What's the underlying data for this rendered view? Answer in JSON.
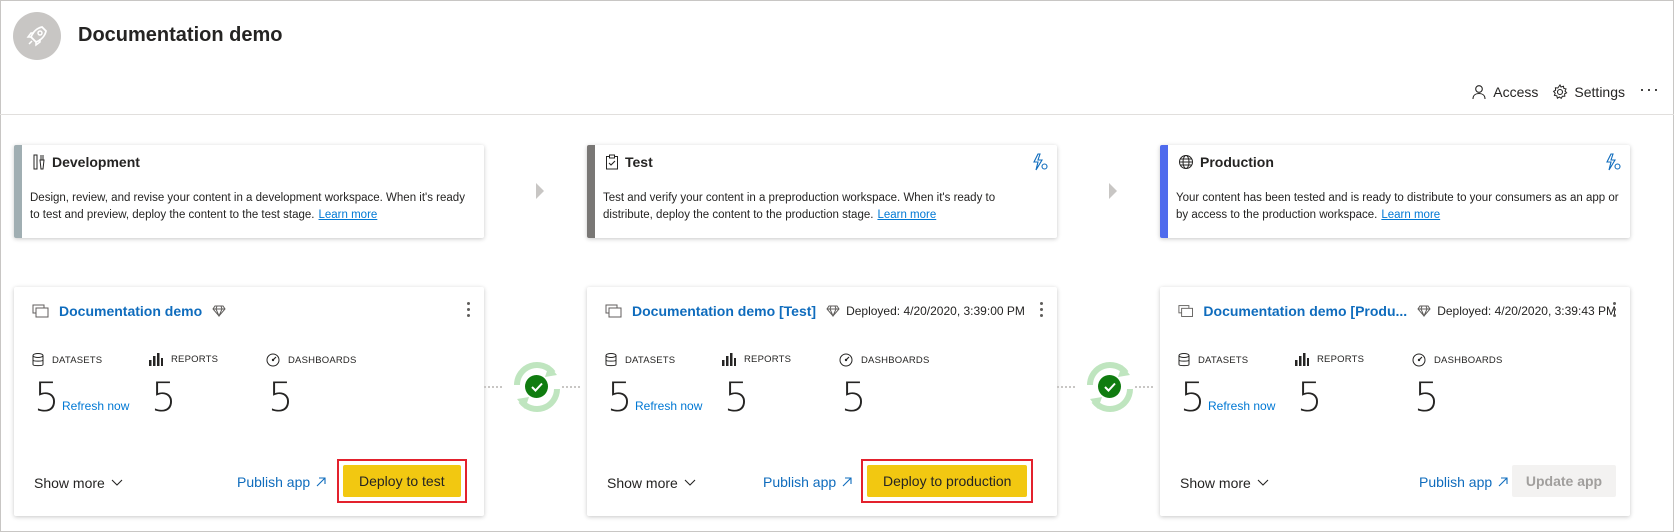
{
  "header": {
    "title": "Documentation demo",
    "access_label": "Access",
    "settings_label": "Settings",
    "more_label": "···"
  },
  "stages": [
    {
      "name": "Development",
      "color": "#a0aeb2",
      "description": "Design, review, and revise your content in a development workspace. When it's ready to test and preview, deploy the content to the test stage.",
      "learn_more": "Learn more",
      "icon": "tools-icon"
    },
    {
      "name": "Test",
      "color": "#797775",
      "description": "Test and verify your content in a preproduction workspace. When it's ready to distribute, deploy the content to the production stage.",
      "learn_more": "Learn more",
      "icon": "clipboard-check-icon"
    },
    {
      "name": "Production",
      "color": "#4f6bed",
      "description": "Your content has been tested and is ready to distribute to your consumers as an app or by access to the production workspace.",
      "learn_more": "Learn more",
      "icon": "globe-icon"
    }
  ],
  "workspaces": [
    {
      "name": "Documentation demo",
      "deployed": "",
      "datasets_label": "DATASETS",
      "datasets_count": "5",
      "refresh_label": "Refresh now",
      "reports_label": "REPORTS",
      "reports_count": "5",
      "dashboards_label": "DASHBOARDS",
      "dashboards_count": "5",
      "show_more": "Show more",
      "publish_app": "Publish app",
      "action_label": "Deploy to test"
    },
    {
      "name": "Documentation demo [Test]",
      "deployed": "Deployed: 4/20/2020, 3:39:00 PM",
      "datasets_label": "DATASETS",
      "datasets_count": "5",
      "refresh_label": "Refresh now",
      "reports_label": "REPORTS",
      "reports_count": "5",
      "dashboards_label": "DASHBOARDS",
      "dashboards_count": "5",
      "show_more": "Show more",
      "publish_app": "Publish app",
      "action_label": "Deploy to production"
    },
    {
      "name": "Documentation demo [Produ...",
      "deployed": "Deployed: 4/20/2020, 3:39:43 PM",
      "datasets_label": "DATASETS",
      "datasets_count": "5",
      "refresh_label": "Refresh now",
      "reports_label": "REPORTS",
      "reports_count": "5",
      "dashboards_label": "DASHBOARDS",
      "dashboards_count": "5",
      "show_more": "Show more",
      "publish_app": "Publish app",
      "action_label": "Update app"
    }
  ],
  "colors": {
    "deploy_button": "#f2c811",
    "highlight_border": "#e3212d",
    "link": "#0f6cbd",
    "sync_ok": "#107c10"
  }
}
